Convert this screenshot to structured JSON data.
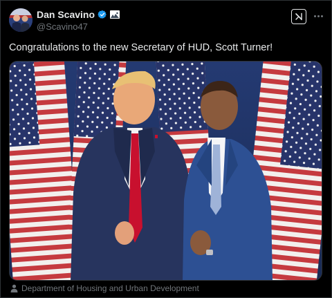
{
  "post": {
    "author": {
      "display_name": "Dan Scavino",
      "handle": "@Scavino47",
      "avatar_icon": "avatar-photo",
      "verified_icon": "verified-badge-icon",
      "affiliation_icon": "government-affiliation-icon"
    },
    "actions": {
      "grok_icon": "grok-icon",
      "more_icon": "more-options-icon"
    },
    "text": "Congratulations to the new Secretary of HUD, Scott Turner!",
    "media": {
      "type": "photo",
      "caption_icon": "person-icon",
      "caption": "Department of Housing and Urban Development"
    }
  },
  "colors": {
    "background": "#000000",
    "text_primary": "#e7e9ea",
    "text_secondary": "#71767b",
    "verified_blue": "#1d9bf0",
    "border": "#2f3336"
  }
}
